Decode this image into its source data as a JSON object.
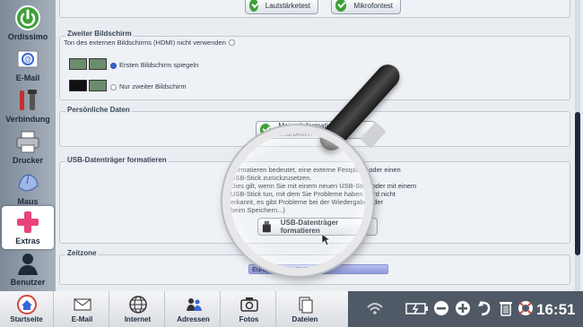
{
  "sidebar": {
    "items": [
      {
        "label": "Ordissimo",
        "icon": "power-icon"
      },
      {
        "label": "E-Mail",
        "icon": "email-icon"
      },
      {
        "label": "Verbindung",
        "icon": "tools-icon"
      },
      {
        "label": "Drucker",
        "icon": "printer-icon"
      },
      {
        "label": "Maus",
        "icon": "mouse-icon"
      },
      {
        "label": "Extras",
        "icon": "plus-icon"
      },
      {
        "label": "Benutzer",
        "icon": "user-icon"
      }
    ],
    "active": "Extras"
  },
  "audio": {
    "btn_volume": "Lautstärketest",
    "btn_mic": "Mikrofontest"
  },
  "screen": {
    "title": "Zweiter Bildschirm",
    "hdmi_label": "Ton des externen Bildschirms (HDMI) nicht verwenden",
    "option_mirror": "Ersten Bildschirm spiegeln",
    "option_second": "Nur zweiter Bildschirm"
  },
  "personal": {
    "title": "Persönliche Daten",
    "btn_edit": "Meine Informationen bearbeiten"
  },
  "usb": {
    "title": "USB-Datenträger formatieren",
    "desc_1": "Formatieren bedeutet, eine externe Festplatte oder einen",
    "desc_2": "USB-Stick zurückzusetzen.",
    "desc_3": "Dies gilt, wenn Sie mit einem neuen USB-Stick oder mit einem",
    "desc_4": "USB-Stick tun, mit dem Sie Probleme haben (wird nicht",
    "desc_5": "erkannt, es gibt Probleme bei der Wiedergabe oder",
    "desc_6": "beim Speichern...)",
    "btn_format": "USB-Datenträger formatieren"
  },
  "timezone": {
    "title": "Zeitzone",
    "value": "Europe/Berlin GMT+1"
  },
  "taskbar": {
    "items": [
      {
        "label": "Startseite",
        "icon": "home-icon"
      },
      {
        "label": "E-Mail",
        "icon": "envelope-icon"
      },
      {
        "label": "Internet",
        "icon": "globe-icon"
      },
      {
        "label": "Adressen",
        "icon": "contacts-icon"
      },
      {
        "label": "Fotos",
        "icon": "camera-icon"
      },
      {
        "label": "Dateien",
        "icon": "files-icon"
      }
    ],
    "clock": "16:51"
  },
  "colors": {
    "accent": "#3766d8",
    "active_item": "#e8447a",
    "check_green": "#3fa13a"
  }
}
